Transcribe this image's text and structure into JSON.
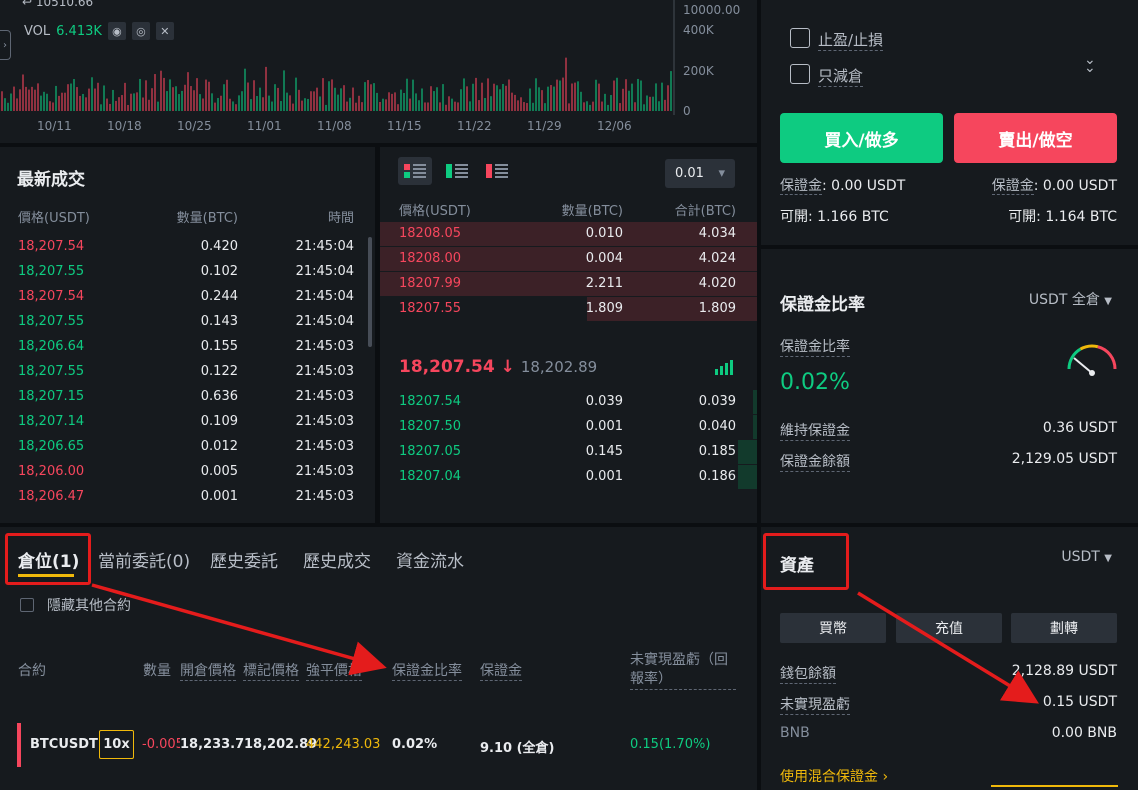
{
  "chart": {
    "price_top": "10510.66",
    "vol_label": "VOL",
    "vol_value": "6.413K",
    "y_labels": [
      "10000.00",
      "400K",
      "200K",
      "0"
    ],
    "x_labels": [
      "10/11",
      "10/18",
      "10/25",
      "11/01",
      "11/08",
      "11/15",
      "11/22",
      "11/29",
      "12/06"
    ]
  },
  "trades": {
    "title": "最新成交",
    "headers": [
      "價格(USDT)",
      "數量(BTC)",
      "時間"
    ],
    "rows": [
      {
        "price": "18,207.54",
        "qty": "0.420",
        "time": "21:45:04",
        "side": "sell"
      },
      {
        "price": "18,207.55",
        "qty": "0.102",
        "time": "21:45:04",
        "side": "buy"
      },
      {
        "price": "18,207.54",
        "qty": "0.244",
        "time": "21:45:04",
        "side": "sell"
      },
      {
        "price": "18,207.55",
        "qty": "0.143",
        "time": "21:45:04",
        "side": "buy"
      },
      {
        "price": "18,206.64",
        "qty": "0.155",
        "time": "21:45:03",
        "side": "buy"
      },
      {
        "price": "18,207.55",
        "qty": "0.122",
        "time": "21:45:03",
        "side": "buy"
      },
      {
        "price": "18,207.15",
        "qty": "0.636",
        "time": "21:45:03",
        "side": "buy"
      },
      {
        "price": "18,207.14",
        "qty": "0.109",
        "time": "21:45:03",
        "side": "buy"
      },
      {
        "price": "18,206.65",
        "qty": "0.012",
        "time": "21:45:03",
        "side": "buy"
      },
      {
        "price": "18,206.00",
        "qty": "0.005",
        "time": "21:45:03",
        "side": "sell"
      },
      {
        "price": "18,206.47",
        "qty": "0.001",
        "time": "21:45:03",
        "side": "sell"
      }
    ]
  },
  "orderbook": {
    "precision": "0.01",
    "headers": [
      "價格(USDT)",
      "數量(BTC)",
      "合計(BTC)"
    ],
    "asks": [
      {
        "price": "18208.05",
        "qty": "0.010",
        "total": "4.034",
        "depth": 1.0
      },
      {
        "price": "18208.00",
        "qty": "0.004",
        "total": "4.024",
        "depth": 1.0
      },
      {
        "price": "18207.99",
        "qty": "2.211",
        "total": "4.020",
        "depth": 1.0
      },
      {
        "price": "18207.55",
        "qty": "1.809",
        "total": "1.809",
        "depth": 0.45
      }
    ],
    "last_price": "18,207.54",
    "last_arrow": "↓",
    "mark_price": "18,202.89",
    "bids": [
      {
        "price": "18207.54",
        "qty": "0.039",
        "total": "0.039",
        "depth": 0.01
      },
      {
        "price": "18207.50",
        "qty": "0.001",
        "total": "0.040",
        "depth": 0.01
      },
      {
        "price": "18207.05",
        "qty": "0.145",
        "total": "0.185",
        "depth": 0.05
      },
      {
        "price": "18207.04",
        "qty": "0.001",
        "total": "0.186",
        "depth": 0.05
      }
    ]
  },
  "positions": {
    "tabs": [
      "倉位(1)",
      "當前委託(0)",
      "歷史委託",
      "歷史成交",
      "資金流水"
    ],
    "hide_other": "隱藏其他合約",
    "headers": {
      "symbol": "合約",
      "qty": "數量",
      "entry": "開倉價格",
      "mark": "標記價格",
      "liq": "強平價格",
      "margin_ratio": "保證金比率",
      "margin": "保證金",
      "pnl": "未實現盈虧（回報率）"
    },
    "row": {
      "symbol": "BTCUSDT",
      "leverage": "10x",
      "qty": "-0.005",
      "entry": "18,233.79",
      "mark": "18,202.89",
      "liq": "442,243.03",
      "margin_ratio": "0.02%",
      "margin": "9.10 (全倉)",
      "pnl": "0.15(1.70%)"
    }
  },
  "sidebar": {
    "tp_sl": "止盈/止損",
    "reduce_only": "只減倉",
    "buy_btn": "買入/做多",
    "sell_btn": "賣出/做空",
    "buy_margin_label": "保證金",
    "buy_margin_value": ": 0.00 USDT",
    "sell_margin_label": "保證金",
    "sell_margin_value": ": 0.00 USDT",
    "buy_avail": "可開: 1.166 BTC",
    "sell_avail": "可開: 1.164 BTC",
    "margin_ratio_title": "保證金比率",
    "margin_ratio_mode": "USDT 全倉",
    "margin_ratio_label": "保證金比率",
    "margin_ratio_value": "0.02%",
    "maint_label": "維持保證金",
    "maint_value": "0.36 USDT",
    "margin_bal_label": "保證金餘額",
    "margin_bal_value": "2,129.05 USDT",
    "assets_title": "資產",
    "assets_ccy": "USDT",
    "btn_buy_crypto": "買幣",
    "btn_deposit": "充值",
    "btn_transfer": "劃轉",
    "wallet_label": "錢包餘額",
    "wallet_value": "2,128.89 USDT",
    "upnl_label": "未實現盈虧",
    "upnl_value": "0.15 USDT",
    "bnb_label": "BNB",
    "bnb_value": "0.00 BNB",
    "mixed_margin": "使用混合保證金"
  },
  "colors": {
    "buy": "#0ecb81",
    "sell": "#f6465d",
    "accent": "#f0b90b",
    "annotation": "#e41c1c"
  }
}
